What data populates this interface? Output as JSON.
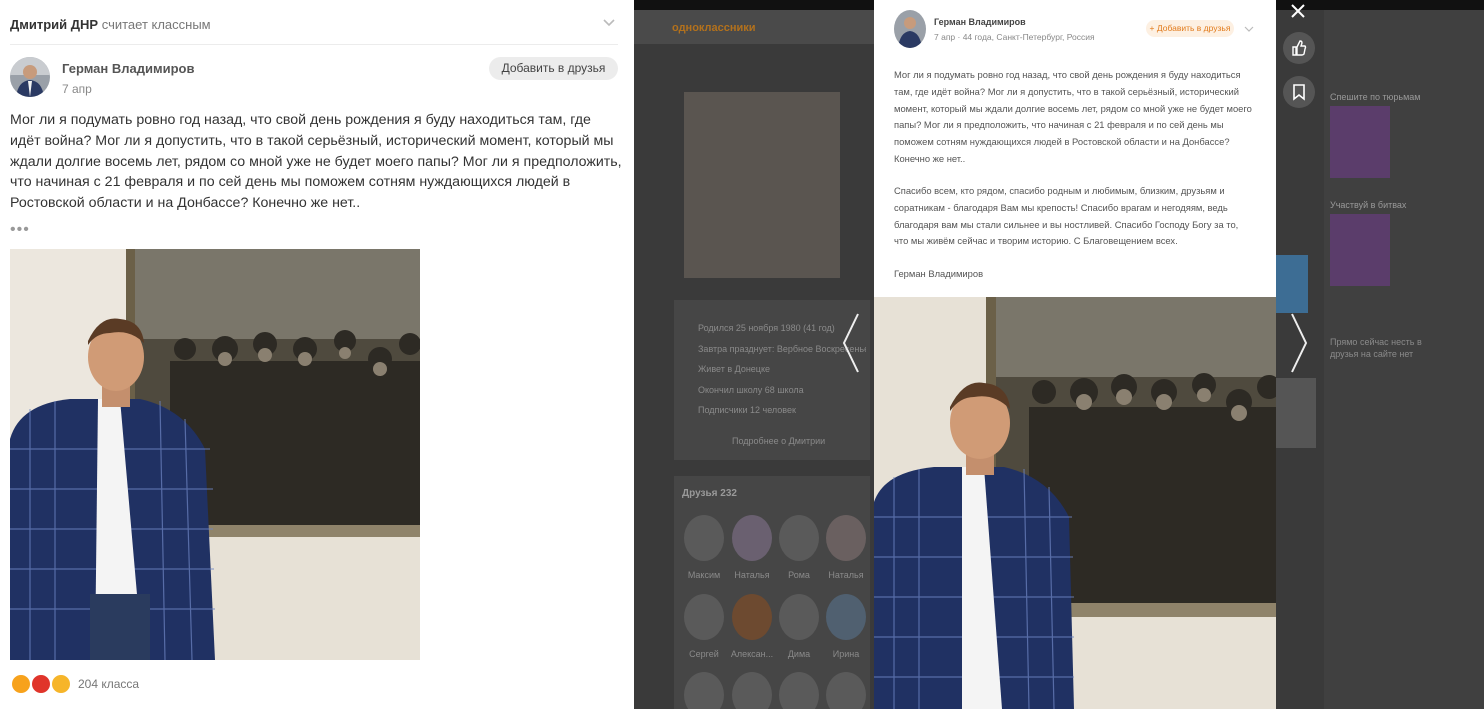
{
  "feed_post": {
    "activity_actor": "Дмитрий ДНР",
    "activity_action": "считает классным",
    "author_name": "Герман Владимиров",
    "post_date": "7 апр",
    "add_friend_label": "Добавить в друзья",
    "text": "Мог ли я подумать ровно год назад,  что свой день рождения я буду находиться там, где идёт война? Мог ли я допустить, что в такой серьёзный, исторический момент, который мы ждали долгие восемь лет, рядом со мной уже не будет моего папы? Мог ли я предположить, что начиная с 21 февраля и по сей день мы поможем сотням нуждающихся людей в Ростовской области и на Донбассе? Конечно же нет..",
    "more": "•••",
    "likes_count": "204 класса",
    "reaction_icons": [
      "thumbs-up-icon",
      "heart-icon",
      "love-eyes-icon"
    ]
  },
  "background_page": {
    "logo": "одноклассники",
    "profile_facts": [
      "Родился 25 ноября 1980 (41 год)",
      "Завтра празднует: Вербное Воскресенье",
      "Живет в Донецке",
      "Окончил школу 68 школа",
      "Подписчики 12 человек"
    ],
    "profile_more": "Подробнее о Дмитрии",
    "friends_title": "Друзья",
    "friends_count": "232",
    "friends": [
      "Максим",
      "Наталья",
      "Рома",
      "Наталья",
      "Сергей",
      "Алексан...",
      "Дима",
      "Ирина"
    ],
    "right_column": [
      "Спешите по тюрьмам",
      "Участвуй в битвах",
      "Прямо сейчас несть в друзья на сайте нет"
    ]
  },
  "overlay_card": {
    "author_name": "Герман Владимиров",
    "meta": "7 апр · 44 года, Санкт-Петербург, Россия",
    "add_friend_label": "+ Добавить в друзья",
    "paragraph_1": "Мог ли я подумать ровно год назад,  что свой день рождения я буду находиться там, где идёт война? Мог ли я допустить, что в такой серьёзный, исторический момент, который мы ждали долгие восемь лет, рядом со мной уже не будет моего папы? Мог ли я предположить, что начиная с 21 февраля и по сей день мы поможем сотням нуждающихся людей в Ростовской области и на Донбассе? Конечно же нет..",
    "paragraph_2": "Спасибо всем, кто рядом, спасибо родным и любимым, близким, друзьям и соратникам - благодаря Вам мы крепость! Спасибо врагам и негодяям, ведь благодаря вам мы стали сильнее и вы ностливей. Спасибо Господу Богу за то, что мы живём сейчас и творим историю. С Благовещением всех.",
    "signature": "Герман Владимиров"
  },
  "overlay_controls": {
    "close_icon": "close-icon",
    "like_icon": "thumbs-up-icon",
    "bookmark_icon": "bookmark-icon",
    "prev_icon": "chevron-left-icon",
    "next_icon": "chevron-right-icon"
  }
}
